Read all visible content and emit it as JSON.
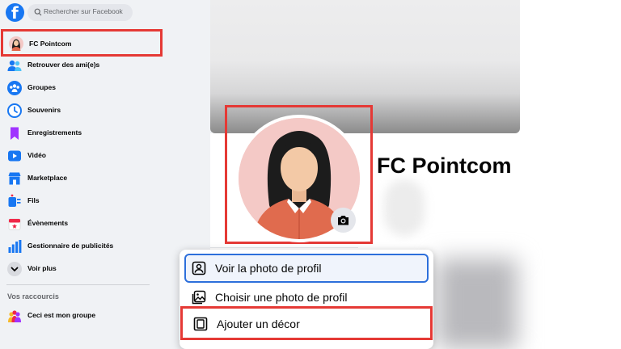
{
  "app": {
    "logo_letter": "f"
  },
  "search": {
    "placeholder": "Rechercher sur Facebook"
  },
  "sidebar": {
    "items": [
      {
        "label": "FC Pointcom",
        "icon": "avatar"
      },
      {
        "label": "Retrouver des ami(e)s",
        "icon": "friends-icon"
      },
      {
        "label": "Groupes",
        "icon": "groups-icon"
      },
      {
        "label": "Souvenirs",
        "icon": "memories-icon"
      },
      {
        "label": "Enregistrements",
        "icon": "bookmark-icon"
      },
      {
        "label": "Vidéo",
        "icon": "video-icon"
      },
      {
        "label": "Marketplace",
        "icon": "marketplace-icon"
      },
      {
        "label": "Fils",
        "icon": "feeds-icon"
      },
      {
        "label": "Évènements",
        "icon": "calendar-icon"
      },
      {
        "label": "Gestionnaire de publicités",
        "icon": "ads-chart-icon"
      },
      {
        "label": "Voir plus",
        "icon": "chevron-down-icon"
      }
    ],
    "shortcuts_title": "Vos raccourcis",
    "shortcuts": [
      {
        "label": "Ceci est mon groupe",
        "icon": "group-shortcut-icon"
      }
    ]
  },
  "profile": {
    "name": "FC Pointcom"
  },
  "menu": {
    "view_label": "Voir la photo de profil",
    "choose_label": "Choisir une photo de profil",
    "decor_label": "Ajouter un décor"
  },
  "colors": {
    "brand": "#1877f2",
    "highlight": "#e53935",
    "focus": "#2d6fdb"
  }
}
